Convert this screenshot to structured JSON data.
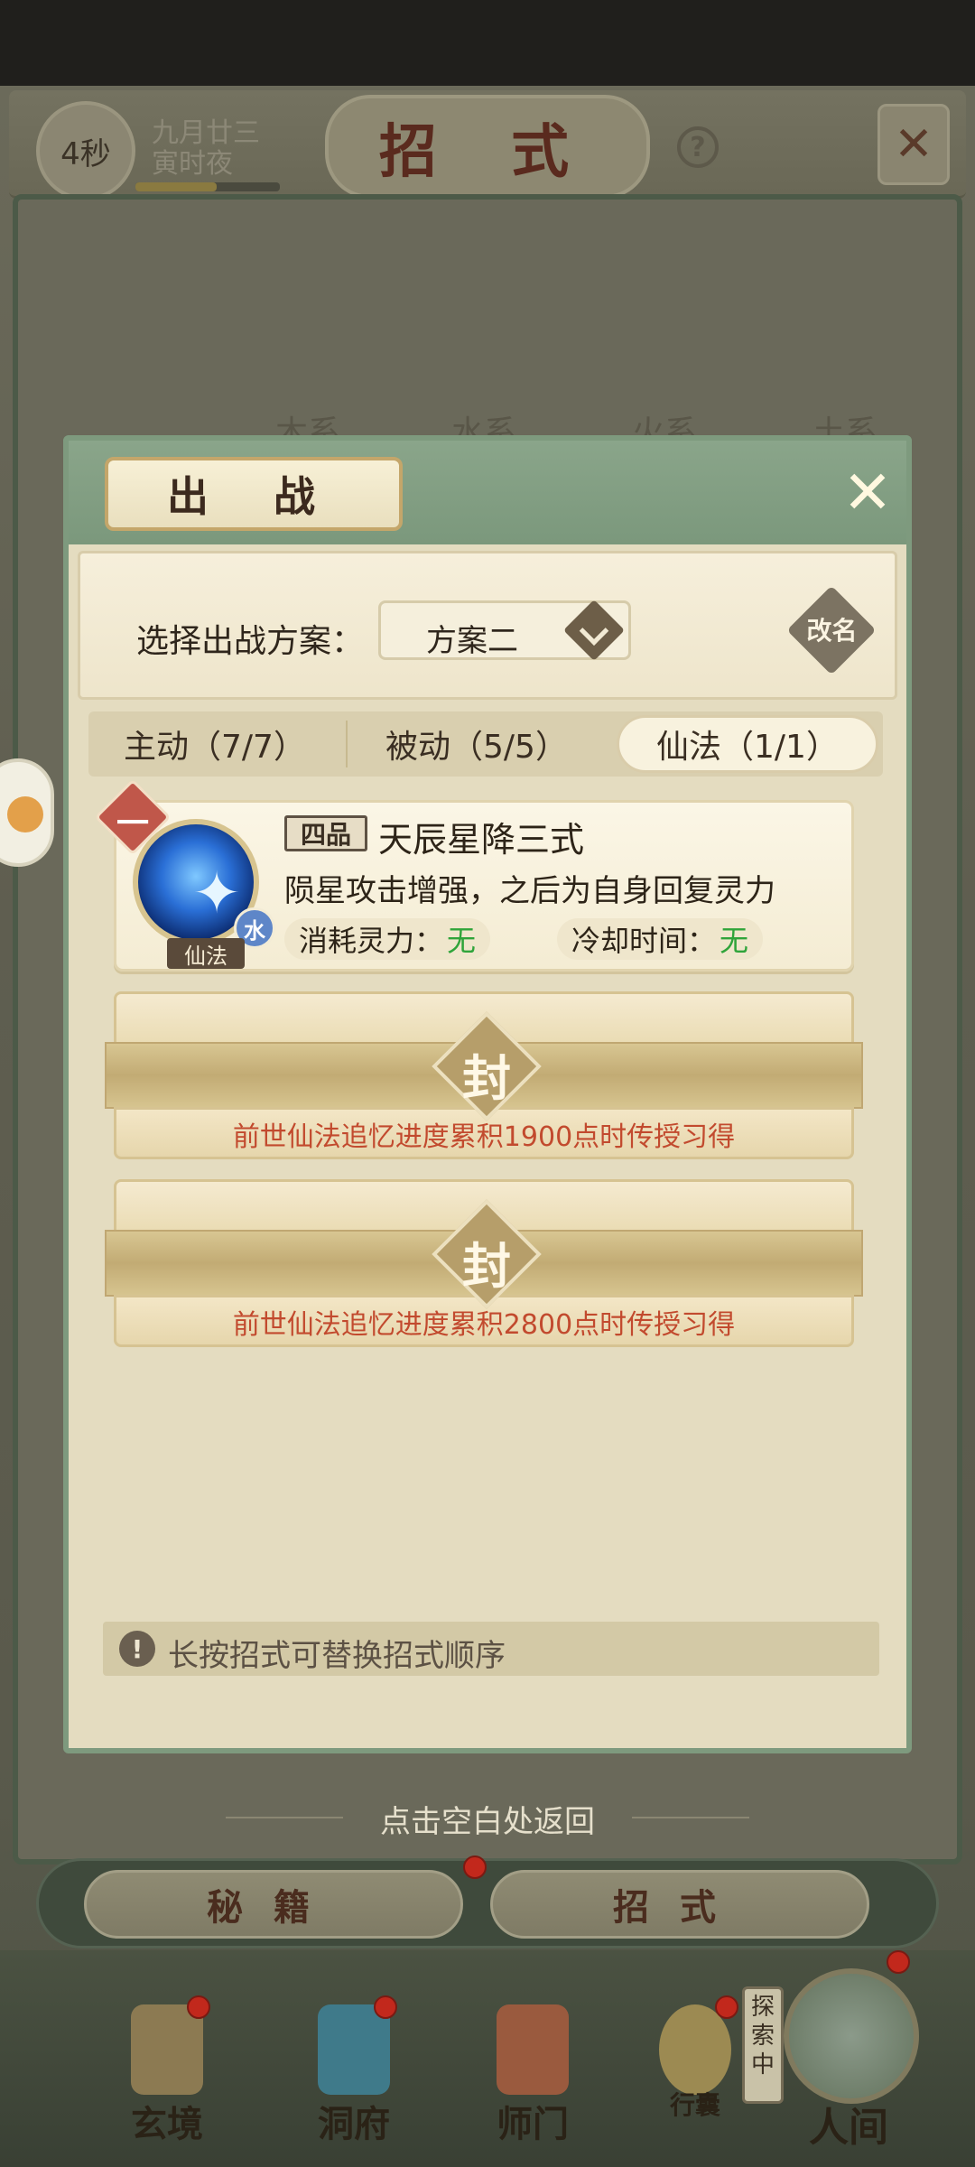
{
  "status": {
    "timer": "4秒",
    "date_line1": "九月廿三",
    "date_line2": "寅时夜",
    "time_progress": 0.56
  },
  "header": {
    "title": "招 式",
    "help_icon": "question-circle-icon",
    "close_icon": "crossed-close-icon"
  },
  "background_tabs": [
    "木系",
    "水系",
    "火系",
    "土系"
  ],
  "modal": {
    "title": "出 战",
    "plan_label": "选择出战方案：",
    "plan_value": "方案二",
    "rename_label": "改名",
    "tabs": [
      {
        "label": "主动（7/7）",
        "active": false
      },
      {
        "label": "被动（5/5）",
        "active": false
      },
      {
        "label": "仙法（1/1）",
        "active": true
      }
    ],
    "skill": {
      "slot": "一",
      "grade": "四品",
      "name": "天辰星降三式",
      "description": "陨星攻击增强，之后为自身回复灵力",
      "element": "水",
      "type": "仙法",
      "cost_label": "消耗灵力：",
      "cost_value": "无",
      "cooldown_label": "冷却时间：",
      "cooldown_value": "无"
    },
    "locked_slots": [
      {
        "seal": "封",
        "requirement": "前世仙法追忆进度累积1900点时传授习得"
      },
      {
        "seal": "封",
        "requirement": "前世仙法追忆进度累积2800点时传授习得"
      }
    ],
    "tip_icon": "!",
    "tip": "长按招式可替换招式顺序"
  },
  "tap_return": "点击空白处返回",
  "bottom_tabs": [
    {
      "label": "秘籍",
      "badge": true
    },
    {
      "label": "招式",
      "badge": false
    }
  ],
  "nav": [
    {
      "label": "玄境",
      "icon": "scroll-icon",
      "badge": true
    },
    {
      "label": "洞府",
      "icon": "lantern-icon",
      "badge": true
    },
    {
      "label": "师门",
      "icon": "banner-icon",
      "badge": false
    },
    {
      "label": "行囊",
      "icon": "bag-icon",
      "badge": true
    }
  ],
  "explore_tag": "探索中",
  "world": {
    "label": "人间",
    "badge": true
  },
  "colors": {
    "modal_green": "#7e9a7e",
    "requirement_red": "#c24a2e",
    "value_green": "#2fa43a",
    "badge_red": "#c2281c"
  }
}
